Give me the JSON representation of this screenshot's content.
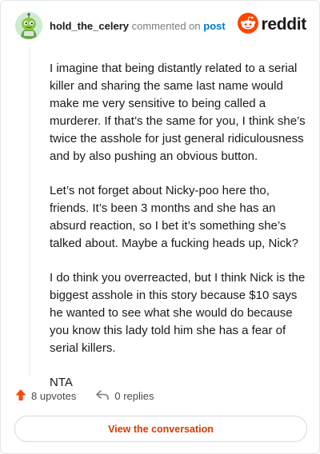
{
  "header": {
    "username": "hold_the_celery",
    "commented_on": "commented on",
    "post_link": "post",
    "brand": "reddit"
  },
  "comment": {
    "paragraphs": [
      "I imagine that being distantly related to a serial killer and sharing the same last name would make me very sensitive to being called a murderer. If that’s the same for you, I think she’s twice the asshole for just general ridiculousness and by also pushing an obvious button.",
      "Let’s not forget about Nicky-poo here tho, friends. It’s been 3 months and she has an absurd reaction, so I bet it’s something she’s talked about. Maybe a fucking heads up, Nick?",
      "I do think you overreacted, but I think Nick is the biggest asshole in this story because $10 says he wanted to see what she would do because you know this lady told him she has a fear of serial killers.",
      "NTA"
    ]
  },
  "actions": {
    "upvotes": "8 upvotes",
    "replies": "0 replies"
  },
  "view_button": "View the conversation",
  "colors": {
    "upvote": "#ff4500",
    "link": "#0079d3",
    "button_text": "#d93a00",
    "brand": "#ff4500"
  },
  "icons": [
    "avatar",
    "reddit-logo-icon",
    "upvote-arrow-icon",
    "reply-arrow-icon"
  ]
}
